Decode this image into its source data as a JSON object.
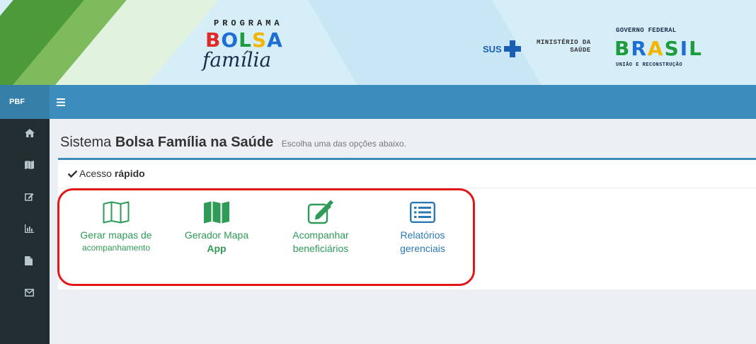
{
  "banner": {
    "programa_label": "PROGRAMA",
    "bolsa_letters": [
      "B",
      "O",
      "L",
      "S",
      "A"
    ],
    "familia_label": "família",
    "sus_label": "SUS",
    "ministerio_line1": "MINISTÉRIO DA",
    "ministerio_line2": "SAÚDE",
    "governo_label": "GOVERNO FEDERAL",
    "brasil_letters": [
      "B",
      "R",
      "A",
      "S",
      "I",
      "L"
    ],
    "uniao_label": "UNIÃO E RECONSTRUÇÃO"
  },
  "topnav": {
    "brand": "PBF",
    "menu_icon": "hamburger-icon"
  },
  "sidebar": {
    "items": [
      {
        "icon": "home-icon"
      },
      {
        "icon": "map-icon"
      },
      {
        "icon": "edit-icon"
      },
      {
        "icon": "bar-chart-icon"
      },
      {
        "icon": "file-icon"
      },
      {
        "icon": "envelope-icon"
      }
    ]
  },
  "page": {
    "title_prefix": "Sistema",
    "title_bold": "Bolsa Família na Saúde",
    "subtitle": "Escolha uma das opções abaixo."
  },
  "quick_access": {
    "title_prefix": "Acesso",
    "title_bold": "rápido",
    "shortcuts": [
      {
        "line1": "Gerar mapas de",
        "line2": "acompanhamento",
        "icon": "map-outline-icon"
      },
      {
        "line1": "Gerador Mapa",
        "line2": "App",
        "icon": "map-solid-icon"
      },
      {
        "line1": "Acompanhar",
        "line2": "beneficiários",
        "icon": "edit-square-icon"
      },
      {
        "line1": "Relatórios",
        "line2": "gerenciais",
        "icon": "list-report-icon"
      }
    ]
  },
  "colors": {
    "topnav": "#3c8dbc",
    "sidebar": "#222d32",
    "shortcut_green": "#2e9b57",
    "shortcut_blue": "#2b79b5",
    "highlight": "#e21717"
  }
}
